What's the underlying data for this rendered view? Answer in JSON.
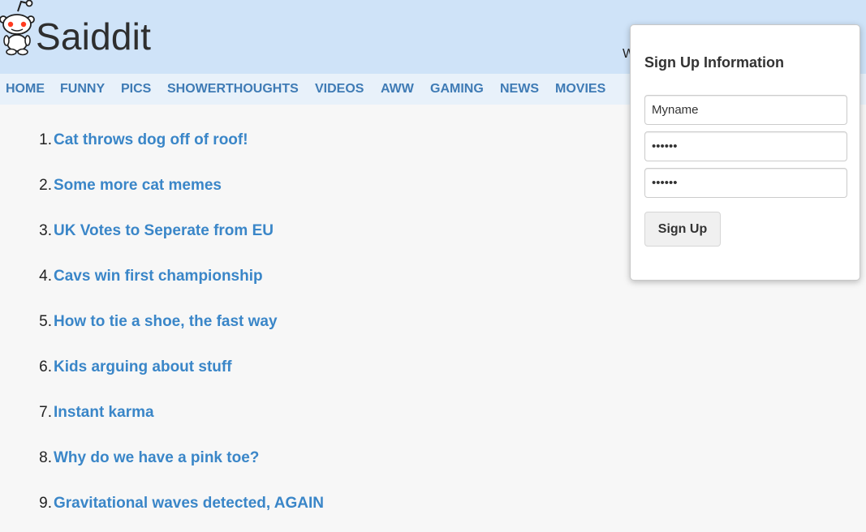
{
  "header": {
    "site_title": "Saiddit",
    "welcome_fragment": "W",
    "logo_icon": "reddit-alien-icon"
  },
  "nav": {
    "items": [
      "HOME",
      "FUNNY",
      "PICS",
      "SHOWERTHOUGHTS",
      "VIDEOS",
      "AWW",
      "GAMING",
      "NEWS",
      "MOVIES"
    ]
  },
  "posts": [
    {
      "num": "1.",
      "title": "Cat throws dog off of roof!"
    },
    {
      "num": "2.",
      "title": "Some more cat memes"
    },
    {
      "num": "3.",
      "title": "UK Votes to Seperate from EU"
    },
    {
      "num": "4.",
      "title": "Cavs win first championship"
    },
    {
      "num": "5.",
      "title": "How to tie a shoe, the fast way"
    },
    {
      "num": "6.",
      "title": "Kids arguing about stuff"
    },
    {
      "num": "7.",
      "title": "Instant karma"
    },
    {
      "num": "8.",
      "title": "Why do we have a pink toe?"
    },
    {
      "num": "9.",
      "title": "Gravitational waves detected, AGAIN"
    }
  ],
  "signup": {
    "title": "Sign Up Information",
    "username_value": "Myname",
    "password_value": "••••••",
    "confirm_value": "••••••",
    "button_label": "Sign Up"
  },
  "colors": {
    "header_bg": "#cfe3f8",
    "nav_bg": "#e8f1fa",
    "nav_link": "#3f7bb5",
    "post_link": "#3a86c8"
  }
}
